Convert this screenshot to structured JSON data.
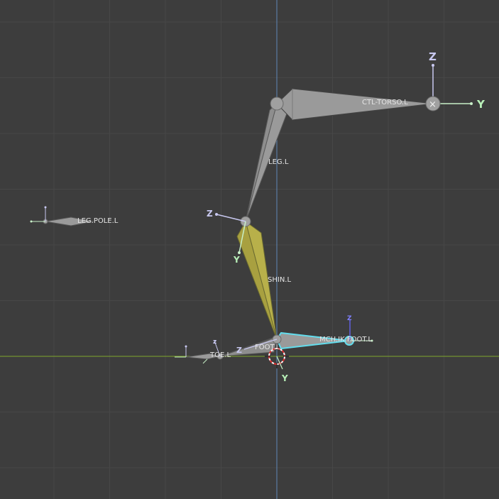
{
  "viewport": {
    "background": "#3d3d3d",
    "grid_color": "#474747",
    "z_axis_color": "#5f88b8",
    "x_axis_color": "#7ea82c",
    "bone_color": "#9a9a9a",
    "selected_bone_color": "#b8b04a",
    "active_outline_color": "#63dcec",
    "axis_tick_color": "#c8c8f0",
    "y_axis_label_color": "#b8f0b8"
  },
  "bones": {
    "ctl_torso": "CTL-TORSO.L",
    "leg": "LEG.L",
    "leg_pole": "LEG.POLE.L",
    "shin": "SHIN.L",
    "foot": "FOOT.L",
    "toe": "TOE.L",
    "mch_ik_foot": "MCH.IK.FOOT.L"
  },
  "axes": {
    "torso_z": "Z",
    "torso_y": "Y",
    "knee_z": "Z",
    "knee_y": "Y",
    "cursor_y": "Y",
    "foot_z": "Z",
    "ik_z": "Z",
    "toe_z": "z"
  }
}
